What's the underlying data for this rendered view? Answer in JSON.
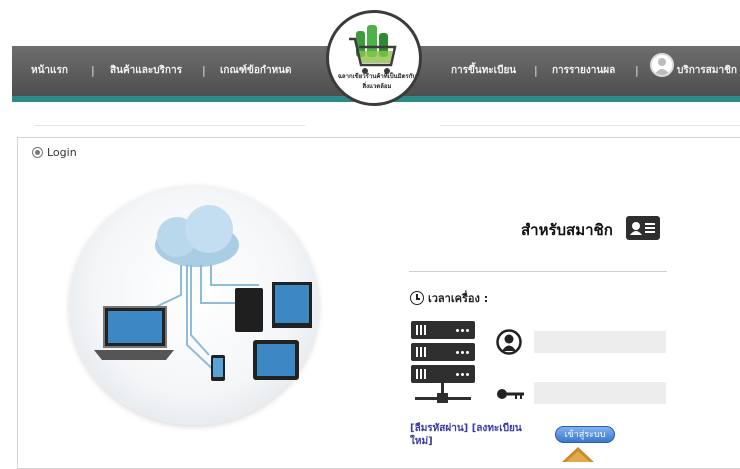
{
  "nav": {
    "items": [
      {
        "label": "หน้าแรก"
      },
      {
        "label": "สินค้าและบริการ"
      },
      {
        "label": "เกณฑ์ข้อกำหนด"
      },
      {
        "label": "การขึ้นทะเบียน"
      },
      {
        "label": "การรายงานผล"
      },
      {
        "label": "บริการสมาชิก"
      }
    ],
    "separator": "|",
    "logo_text": "ฉลากเขียวร้านค้าที่เป็นมิตรกับสิ่งแวดล้อม"
  },
  "login": {
    "tab_label": "Login",
    "member_title": "สำหรับสมาชิก",
    "clock_label": "เวลาเครื่อง :",
    "username_value": "",
    "password_value": "",
    "forgot_link": "[ลืมรหัสผ่าน]",
    "register_link": "[ลงทะเบียนใหม่]",
    "submit_label": "เข้าสู่ระบบ"
  },
  "colors": {
    "nav_bg": "#5a5a5a",
    "accent_teal": "#2a8a88",
    "link": "#3a3aa8",
    "button": "#3a78cf",
    "arrow": "#e0a94a"
  },
  "icons": [
    "clock-icon",
    "server-icon",
    "user-icon",
    "key-icon",
    "member-card-icon",
    "cloud-network-icon"
  ]
}
